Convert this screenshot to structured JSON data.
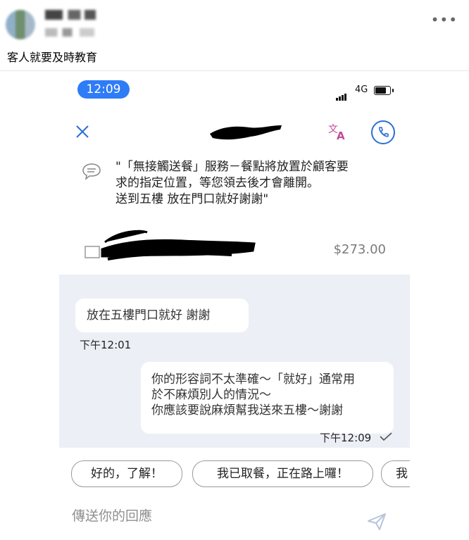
{
  "post": {
    "caption": "客人就要及時教育",
    "more_icon": "more-horizontal-icon"
  },
  "app": {
    "status_time": "12:09",
    "network": "4G",
    "delivery_note": "\"「無接觸送餐」服務－餐點將放置於顧客要\n求的指定位置，等您領去後才會離開。\n送到五樓 放在門口就好謝謝\"",
    "order_total": "$273.00",
    "chat": {
      "incoming_text": "放在五樓門口就好 謝謝",
      "incoming_time": "下午12:01",
      "outgoing_text": "你的形容詞不太準確～「就好」通常用\n於不麻煩別人的情況～\n你應該要說麻煩幫我送來五樓～謝謝",
      "outgoing_time": "下午12:09"
    },
    "quick_replies": [
      "好的，了解！",
      "我已取餐，正在路上囉！",
      "我"
    ],
    "reply_placeholder": "傳送你的回應"
  },
  "colors": {
    "accent_blue": "#2e7cf6",
    "translate_pink": "#c14b95",
    "chat_bg": "#eceff5"
  }
}
